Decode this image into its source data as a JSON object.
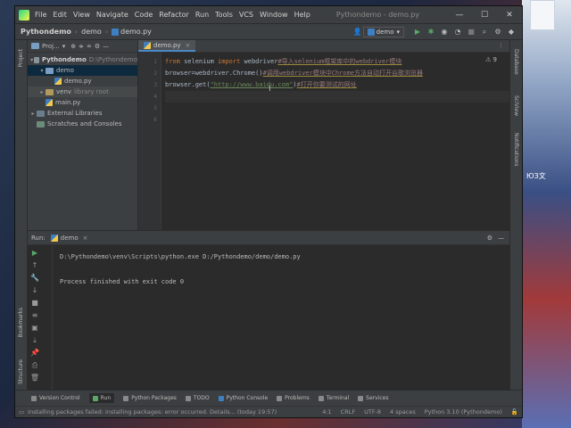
{
  "menubar": {
    "items": [
      "File",
      "Edit",
      "View",
      "Navigate",
      "Code",
      "Refactor",
      "Run",
      "Tools",
      "VCS",
      "Window",
      "Help"
    ],
    "title": "Pythondemo - demo.py",
    "minimize": "—",
    "maximize": "☐",
    "close": "✕"
  },
  "navbar": {
    "project": "Pythondemo",
    "folder": "demo",
    "file": "demo.py",
    "run_config": "demo",
    "run_config_arrow": "▾"
  },
  "project_panel": {
    "header": "Proj...",
    "tree": {
      "root_name": "Pythondemo",
      "root_path": "D:\\Pythondemo",
      "demo_folder": "demo",
      "demo_file": "demo.py",
      "venv_name": "venv",
      "venv_note": "library root",
      "main_file": "main.py",
      "external_libs": "External Libraries",
      "scratches": "Scratches and Consoles"
    }
  },
  "editor": {
    "tab_label": "demo.py",
    "tab_close": "×",
    "warning_count": "⚠ 9",
    "line_numbers": [
      "1",
      "2",
      "3",
      "4",
      "5",
      "6"
    ],
    "line1": {
      "kw1": "from",
      "mod": " selenium ",
      "kw2": "import",
      "name": " webdriver",
      "comment": "#导入selenium框架库中的webdriver模块"
    },
    "line2": {
      "code": "browser=webdriver.Chrome()",
      "comment": "#调用webdriver模块中Chrome方法自动打开谷歌浏览器"
    },
    "line3": {
      "pre": "browser.get(",
      "url": "\"http://www.baidu.com\"",
      "post": ")",
      "comment": "#打开你要测试的网址"
    }
  },
  "run_panel": {
    "label": "Run:",
    "tab": "demo",
    "console_cmd": "D:\\Pythondemo\\venv\\Scripts\\python.exe D:/Pythondemo/demo/demo.py",
    "console_exit": "Process finished with exit code 0"
  },
  "left_strip": {
    "project": "Project",
    "bookmarks": "Bookmarks",
    "structure": "Structure"
  },
  "right_strip": {
    "database": "Database",
    "sciview": "SciView",
    "notifications": "Notifications"
  },
  "bottom_tabs": [
    "Version Control",
    "Run",
    "Python Packages",
    "TODO",
    "Python Console",
    "Problems",
    "Terminal",
    "Services"
  ],
  "statusbar": {
    "message": "Installing packages failed: installing packages: error occurred. Details... (today 19:57)",
    "position": "4:1",
    "line_sep": "CRLF",
    "encoding": "UTF-8",
    "indent": "4 spaces",
    "interpreter": "Python 3.10 (Pythondemo)"
  },
  "desktop": {
    "label": "ЮЗ文"
  }
}
